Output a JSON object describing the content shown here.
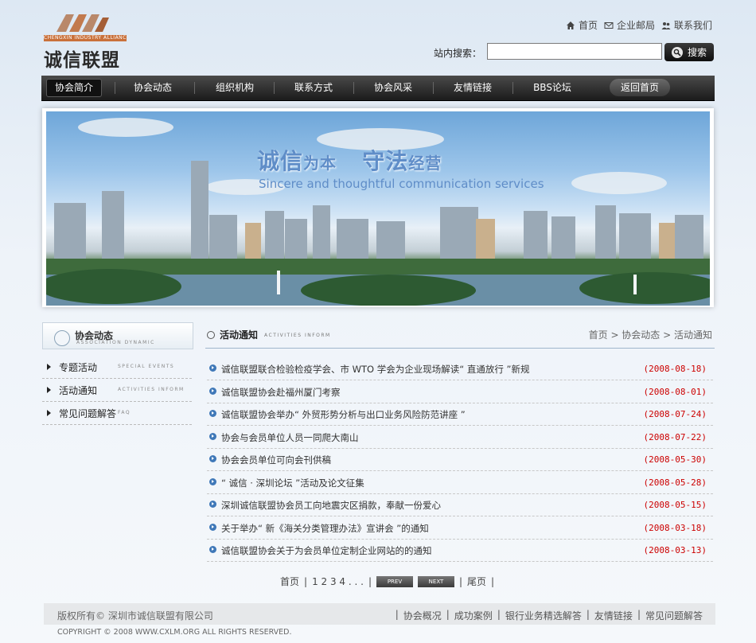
{
  "header": {
    "logo_sub": "CHENGXIN INDUSTRY ALLIANCE CO.,LTD",
    "logo_name": "诚信联盟",
    "top_links": [
      "首页",
      "企业邮局",
      "联系我们"
    ],
    "search_label": "站内搜索：",
    "search_value": "",
    "search_button": "搜索"
  },
  "nav": {
    "items": [
      "协会简介",
      "协会动态",
      "组织机构",
      "联系方式",
      "协会风采",
      "友情链接",
      "BBS论坛"
    ],
    "home": "返回首页"
  },
  "banner": {
    "slogan_cn_1a": "诚信",
    "slogan_cn_1b": "为本",
    "slogan_cn_2a": "守法",
    "slogan_cn_2b": "经营",
    "slogan_en": "Sincere and thoughtful communication services"
  },
  "sidebar": {
    "title": "协会动态",
    "title_en": "ASSOCIATION DYNAMIC",
    "items": [
      {
        "label": "专题活动",
        "en": "SPECIAL EVENTS"
      },
      {
        "label": "活动通知",
        "en": "ACTIVITIES INFORM"
      },
      {
        "label": "常见问题解答",
        "en": "FAQ"
      }
    ]
  },
  "main": {
    "title": "活动通知",
    "title_en": "ACTIVITIES INFORM",
    "breadcrumb": "首页 > 协会动态 > 活动通知",
    "news": [
      {
        "title": "诚信联盟联合检验检疫学会、市 WTO 学会为企业现场解读“ 直通放行 ”新规",
        "date": "(2008-08-18)"
      },
      {
        "title": "诚信联盟协会赴福州厦门考察",
        "date": "(2008-08-01)"
      },
      {
        "title": "诚信联盟协会举办“ 外贸形势分析与出口业务风险防范讲座 ”",
        "date": "(2008-07-24)"
      },
      {
        "title": "协会与会员单位人员一同爬大南山",
        "date": "(2008-07-22)"
      },
      {
        "title": "协会会员单位可向会刊供稿",
        "date": "(2008-05-30)"
      },
      {
        "title": "“ 诚信 · 深圳论坛 ”活动及论文征集",
        "date": "(2008-05-28)"
      },
      {
        "title": "深圳诚信联盟协会员工向地震灾区捐款，奉献一份爱心",
        "date": "(2008-05-15)"
      },
      {
        "title": "关于举办“ 新《海关分类管理办法》宣讲会 ”的通知",
        "date": "(2008-03-18)"
      },
      {
        "title": "诚信联盟协会关于为会员单位定制企业网站的的通知",
        "date": "(2008-03-13)"
      }
    ]
  },
  "pager": {
    "first": "首页",
    "pages": "1 2 3 4 . . .",
    "prev": "PREV",
    "next": "NEXT",
    "last": "尾页"
  },
  "footer": {
    "copy": "版权所有© 深圳市诚信联盟有限公司",
    "links": [
      "协会概况",
      "成功案例",
      "银行业务精选解答",
      "友情链接",
      "常见问题解答"
    ],
    "copyright_en": "COPYRIGHT © 2008 WWW.CXLM.ORG ALL RIGHTS RESERVED."
  }
}
